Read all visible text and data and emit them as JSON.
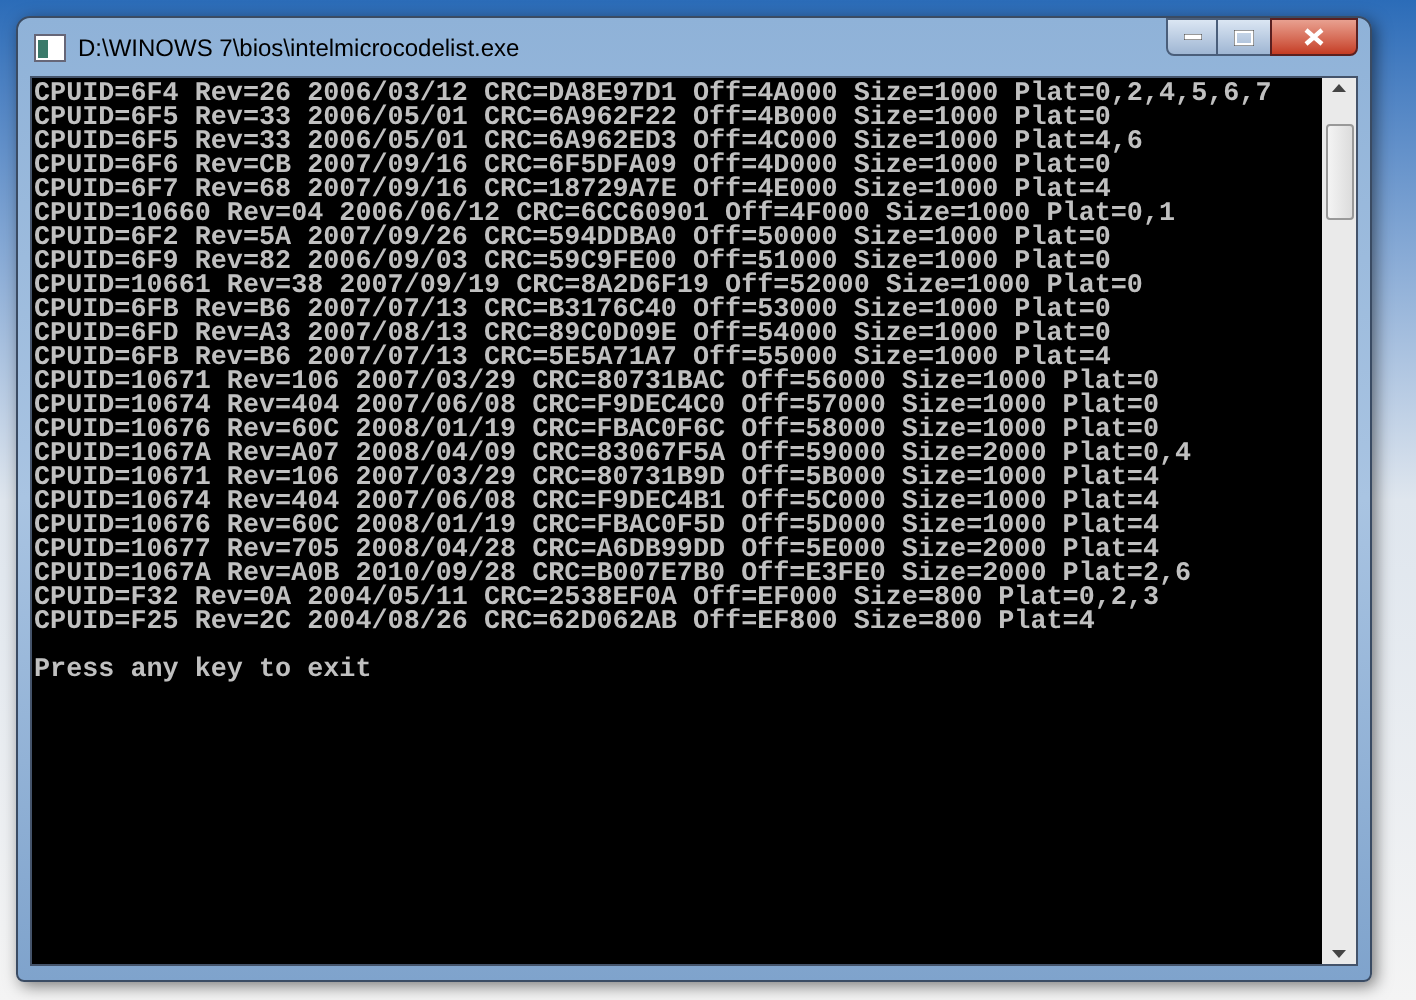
{
  "window": {
    "title": "D:\\WINOWS 7\\bios\\intelmicrocodelist.exe"
  },
  "console": {
    "lines": [
      "CPUID=6F4 Rev=26 2006/03/12 CRC=DA8E97D1 Off=4A000 Size=1000 Plat=0,2,4,5,6,7",
      "CPUID=6F5 Rev=33 2006/05/01 CRC=6A962F22 Off=4B000 Size=1000 Plat=0",
      "CPUID=6F5 Rev=33 2006/05/01 CRC=6A962ED3 Off=4C000 Size=1000 Plat=4,6",
      "CPUID=6F6 Rev=CB 2007/09/16 CRC=6F5DFA09 Off=4D000 Size=1000 Plat=0",
      "CPUID=6F7 Rev=68 2007/09/16 CRC=18729A7E Off=4E000 Size=1000 Plat=4",
      "CPUID=10660 Rev=04 2006/06/12 CRC=6CC60901 Off=4F000 Size=1000 Plat=0,1",
      "CPUID=6F2 Rev=5A 2007/09/26 CRC=594DDBA0 Off=50000 Size=1000 Plat=0",
      "CPUID=6F9 Rev=82 2006/09/03 CRC=59C9FE00 Off=51000 Size=1000 Plat=0",
      "CPUID=10661 Rev=38 2007/09/19 CRC=8A2D6F19 Off=52000 Size=1000 Plat=0",
      "CPUID=6FB Rev=B6 2007/07/13 CRC=B3176C40 Off=53000 Size=1000 Plat=0",
      "CPUID=6FD Rev=A3 2007/08/13 CRC=89C0D09E Off=54000 Size=1000 Plat=0",
      "CPUID=6FB Rev=B6 2007/07/13 CRC=5E5A71A7 Off=55000 Size=1000 Plat=4",
      "CPUID=10671 Rev=106 2007/03/29 CRC=80731BAC Off=56000 Size=1000 Plat=0",
      "CPUID=10674 Rev=404 2007/06/08 CRC=F9DEC4C0 Off=57000 Size=1000 Plat=0",
      "CPUID=10676 Rev=60C 2008/01/19 CRC=FBAC0F6C Off=58000 Size=1000 Plat=0",
      "CPUID=1067A Rev=A07 2008/04/09 CRC=83067F5A Off=59000 Size=2000 Plat=0,4",
      "CPUID=10671 Rev=106 2007/03/29 CRC=80731B9D Off=5B000 Size=1000 Plat=4",
      "CPUID=10674 Rev=404 2007/06/08 CRC=F9DEC4B1 Off=5C000 Size=1000 Plat=4",
      "CPUID=10676 Rev=60C 2008/01/19 CRC=FBAC0F5D Off=5D000 Size=1000 Plat=4",
      "CPUID=10677 Rev=705 2008/04/28 CRC=A6DB99DD Off=5E000 Size=2000 Plat=4",
      "CPUID=1067A Rev=A0B 2010/09/28 CRC=B007E7B0 Off=E3FE0 Size=2000 Plat=2,6",
      "CPUID=F32 Rev=0A 2004/05/11 CRC=2538EF0A Off=EF000 Size=800 Plat=0,2,3",
      "CPUID=F25 Rev=2C 2004/08/26 CRC=62D062AB Off=EF800 Size=800 Plat=4"
    ],
    "prompt": "Press any key to exit"
  }
}
